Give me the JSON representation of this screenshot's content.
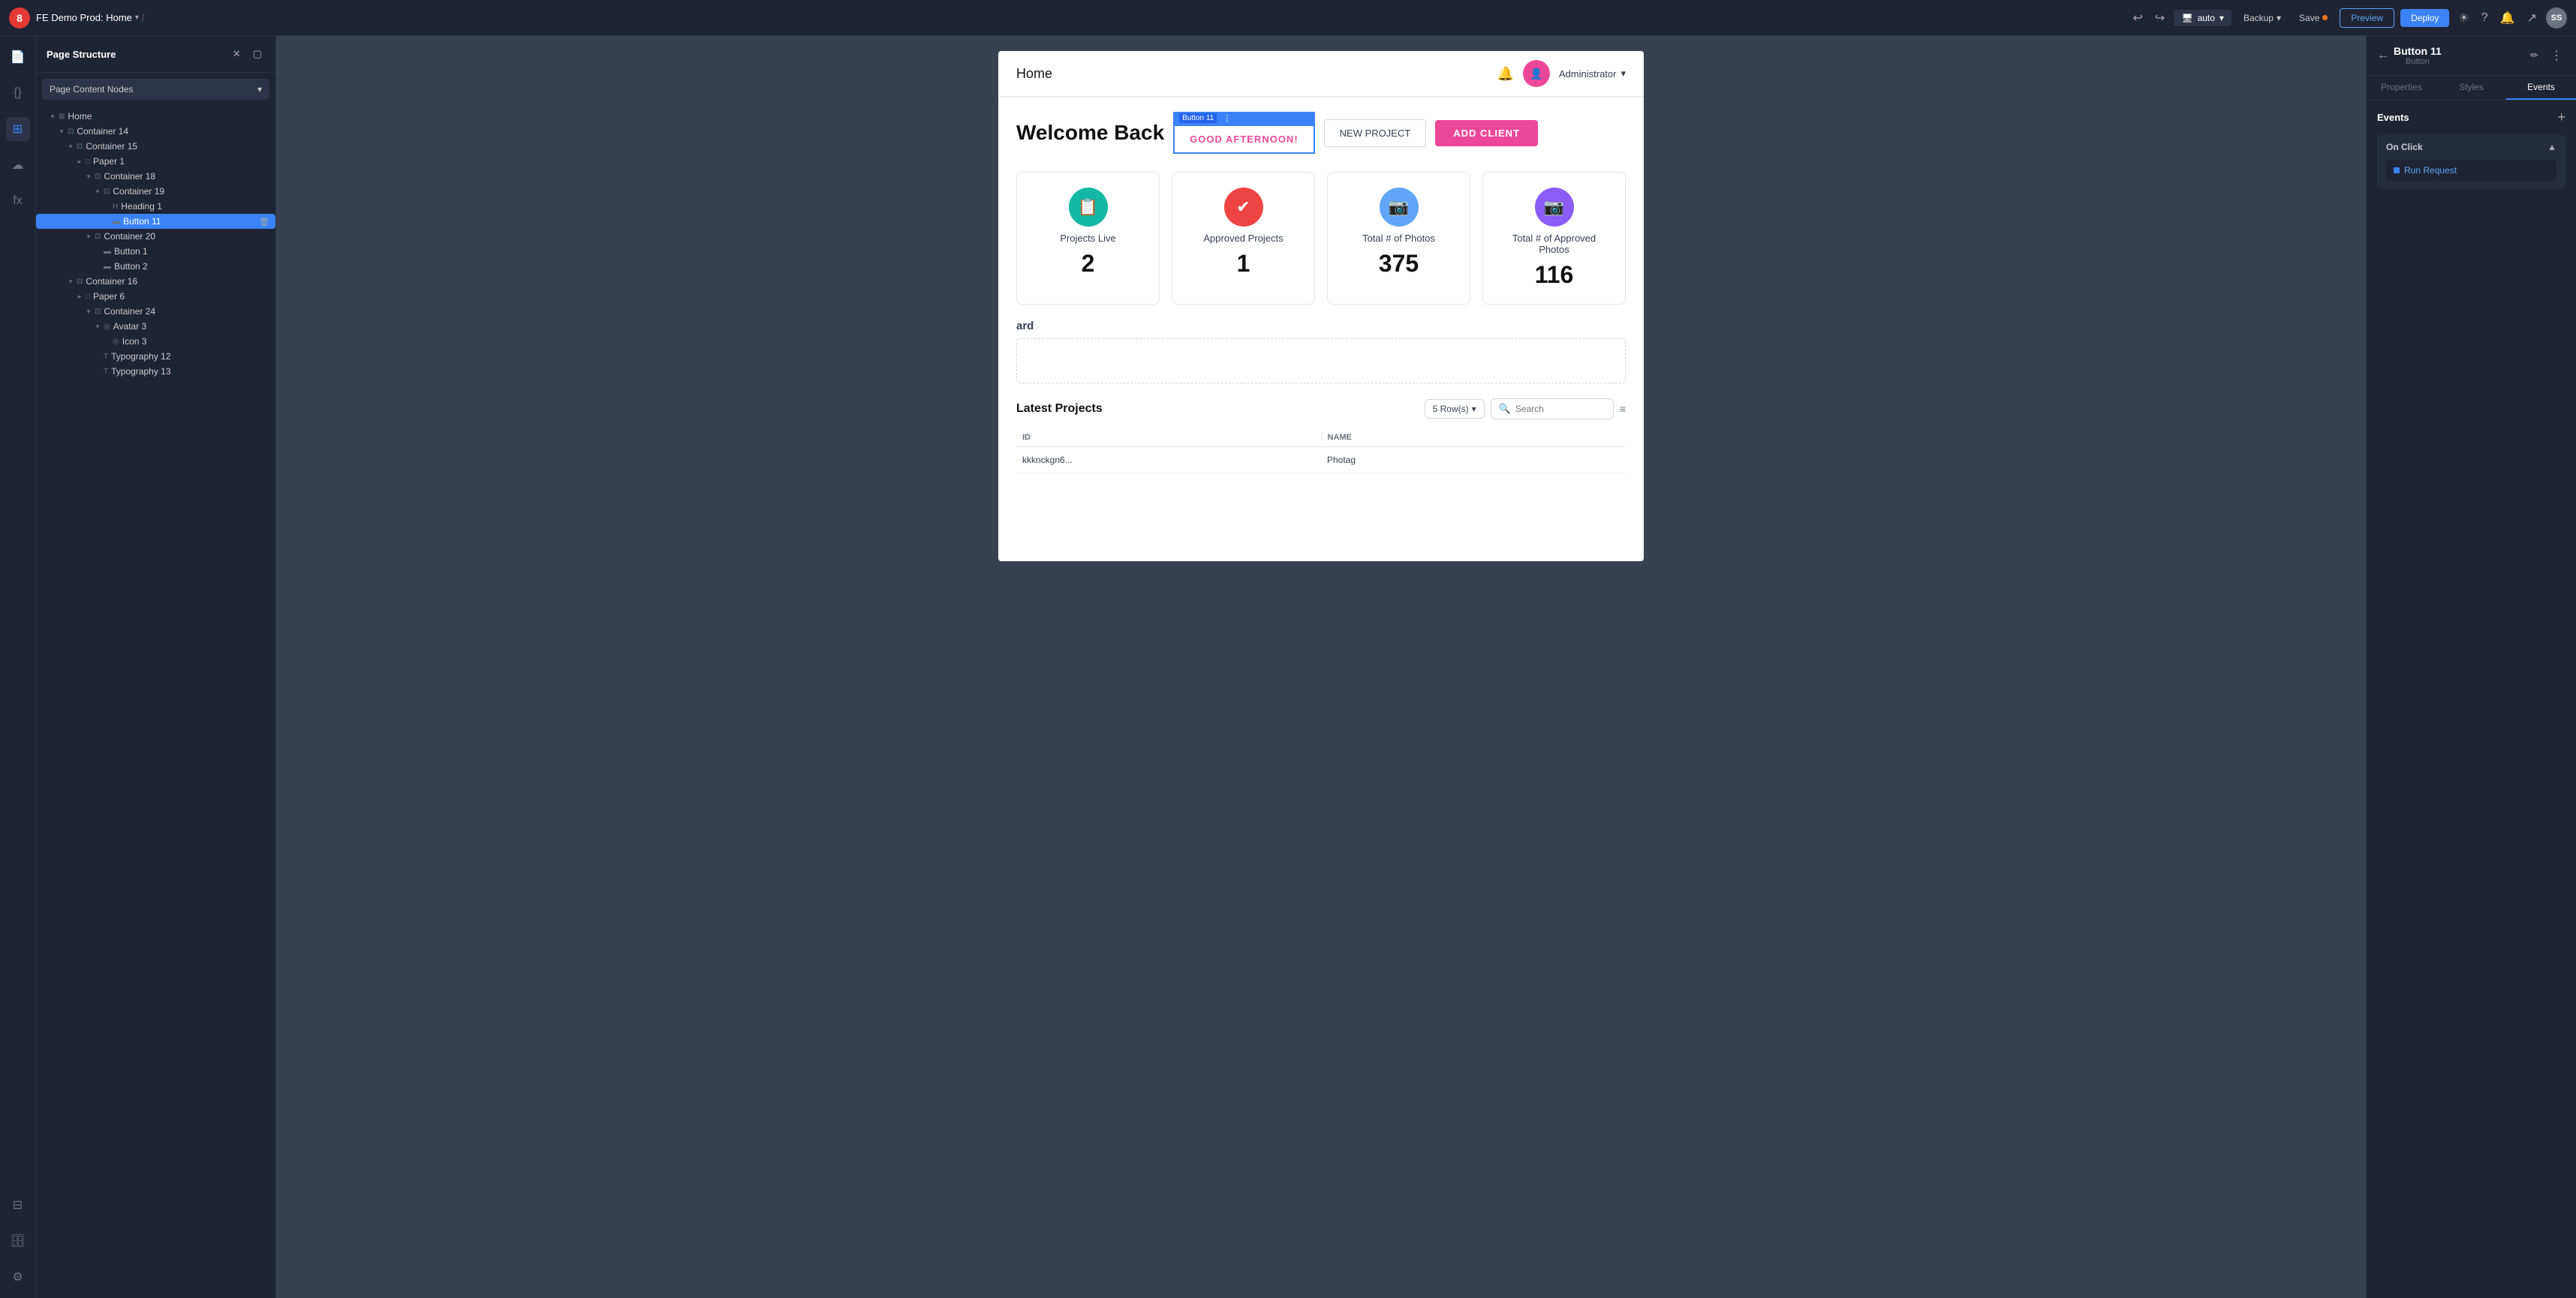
{
  "topbar": {
    "logo": "8",
    "project_name": "FE Demo Prod: Home",
    "breadcrumb_slash": "/",
    "undo_icon": "↩",
    "redo_icon": "↪",
    "device_label": "auto",
    "backup_label": "Backup",
    "save_label": "Save",
    "preview_label": "Preview",
    "deploy_label": "Deploy",
    "avatar_initials": "SS"
  },
  "left_panel": {
    "title": "Page Structure",
    "dropdown_label": "Page Content Nodes",
    "tree": [
      {
        "id": "home",
        "label": "Home",
        "icon": "⊞",
        "indent": 1,
        "expanded": true,
        "type": "page"
      },
      {
        "id": "container-14",
        "label": "Container 14",
        "icon": "⊡",
        "indent": 2,
        "expanded": true,
        "type": "container"
      },
      {
        "id": "container-15",
        "label": "Container 15",
        "icon": "⊡",
        "indent": 3,
        "expanded": true,
        "type": "container"
      },
      {
        "id": "paper-1",
        "label": "Paper 1",
        "icon": "□",
        "indent": 4,
        "expanded": false,
        "type": "paper"
      },
      {
        "id": "container-18",
        "label": "Container 18",
        "icon": "⊡",
        "indent": 5,
        "expanded": true,
        "type": "container"
      },
      {
        "id": "container-19",
        "label": "Container 19",
        "icon": "⊡",
        "indent": 6,
        "expanded": true,
        "type": "container"
      },
      {
        "id": "heading-1",
        "label": "Heading 1",
        "icon": "H",
        "indent": 7,
        "expanded": false,
        "type": "heading"
      },
      {
        "id": "button-11",
        "label": "Button 11",
        "icon": "▬",
        "indent": 7,
        "expanded": false,
        "type": "button",
        "selected": true
      },
      {
        "id": "container-20",
        "label": "Container 20",
        "icon": "⊡",
        "indent": 5,
        "expanded": true,
        "type": "container"
      },
      {
        "id": "button-1",
        "label": "Button 1",
        "icon": "▬",
        "indent": 6,
        "expanded": false,
        "type": "button"
      },
      {
        "id": "button-2",
        "label": "Button 2",
        "icon": "▬",
        "indent": 6,
        "expanded": false,
        "type": "button"
      },
      {
        "id": "container-16",
        "label": "Container 16",
        "icon": "⊡",
        "indent": 3,
        "expanded": true,
        "type": "container"
      },
      {
        "id": "paper-6",
        "label": "Paper 6",
        "icon": "□",
        "indent": 4,
        "expanded": false,
        "type": "paper"
      },
      {
        "id": "container-24",
        "label": "Container 24",
        "icon": "⊡",
        "indent": 5,
        "expanded": true,
        "type": "container"
      },
      {
        "id": "avatar-3",
        "label": "Avatar 3",
        "icon": "◎",
        "indent": 6,
        "expanded": true,
        "type": "avatar"
      },
      {
        "id": "icon-3",
        "label": "Icon 3",
        "icon": "◎",
        "indent": 7,
        "expanded": false,
        "type": "icon"
      },
      {
        "id": "typography-12",
        "label": "Typography 12",
        "icon": "T",
        "indent": 6,
        "expanded": false,
        "type": "typography"
      },
      {
        "id": "typography-13",
        "label": "Typography 13",
        "icon": "T",
        "indent": 6,
        "expanded": false,
        "type": "typography"
      }
    ]
  },
  "canvas": {
    "app_header": {
      "title": "Home",
      "user_name": "Administrator",
      "user_avatar": "👤"
    },
    "welcome": {
      "text": "Welcome Back",
      "good_afternoon_btn": "GOOD AFTERNOON!",
      "new_project_btn": "NEW PROJECT",
      "add_client_btn": "ADD CLIENT",
      "selected_button_label": "Button 11"
    },
    "stats": [
      {
        "label": "Projects Live",
        "value": "2",
        "icon": "📋",
        "color": "teal"
      },
      {
        "label": "Approved Projects",
        "value": "1",
        "icon": "✔",
        "color": "red"
      },
      {
        "label": "Total # of Photos",
        "value": "375",
        "icon": "📷",
        "color": "blue"
      },
      {
        "label": "Total # of Approved Photos",
        "value": "116",
        "icon": "📷",
        "color": "purple"
      }
    ],
    "dashboard_title": "ard",
    "projects": {
      "title": "Latest Projects",
      "rows_label": "5 Row(s)",
      "search_placeholder": "Search",
      "columns": [
        "Id",
        "Name"
      ],
      "rows": [
        {
          "id": "kkknckgn6...",
          "name": "Photag"
        }
      ]
    }
  },
  "right_panel": {
    "back_icon": "←",
    "element_name": "Button 11",
    "element_type": "Button",
    "edit_icon": "✏",
    "more_icon": "⋮",
    "tabs": [
      "Properties",
      "Styles",
      "Events"
    ],
    "active_tab": "Events",
    "events_title": "Events",
    "add_icon": "+",
    "on_click_label": "On Click",
    "chevron_up": "▲",
    "run_request_label": "Run Request"
  }
}
